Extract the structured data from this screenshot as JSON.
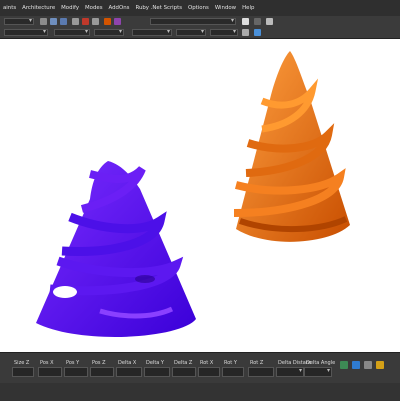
{
  "menubar": {
    "items": [
      "aints",
      "Architecture",
      "Modify",
      "Modes",
      "AddOns",
      "Ruby .Net Scripts",
      "Options",
      "Window",
      "Help"
    ]
  },
  "statusbar": {
    "fields": [
      "Size Z",
      "Pos X",
      "Pos Y",
      "Pos Z",
      "Delta X",
      "Delta Y",
      "Delta Z",
      "Rot X",
      "Rot Y",
      "Rot Z",
      "Delta Distanc",
      "Delta Angle"
    ]
  },
  "colors": {
    "chrome": "#3a3a3a",
    "viewport": "#ffffff",
    "purple_cone": "#5a14f0",
    "orange_cone": "#f07814"
  },
  "icons": {
    "toolbar": [
      "save-icon",
      "undo-icon",
      "redo-icon",
      "cut-icon",
      "copy-icon",
      "paste-icon",
      "render-icon",
      "help-icon"
    ],
    "status": [
      "snap-icon",
      "grid-icon",
      "ortho-icon",
      "lock-icon"
    ]
  }
}
